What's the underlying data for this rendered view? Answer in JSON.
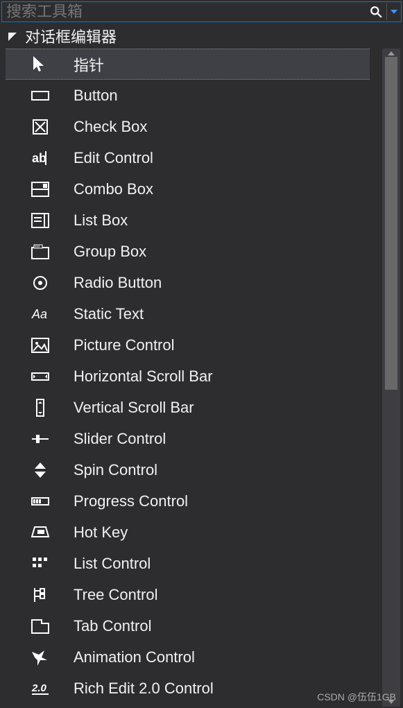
{
  "search": {
    "placeholder": "搜索工具箱"
  },
  "category": {
    "title": "对话框编辑器"
  },
  "items": [
    {
      "id": "pointer",
      "label": "指针",
      "icon": "pointer-icon",
      "selected": true
    },
    {
      "id": "button",
      "label": "Button",
      "icon": "button-icon",
      "selected": false
    },
    {
      "id": "check-box",
      "label": "Check Box",
      "icon": "checkbox-icon",
      "selected": false
    },
    {
      "id": "edit-control",
      "label": "Edit Control",
      "icon": "edit-icon",
      "selected": false
    },
    {
      "id": "combo-box",
      "label": "Combo Box",
      "icon": "combobox-icon",
      "selected": false
    },
    {
      "id": "list-box",
      "label": "List Box",
      "icon": "listbox-icon",
      "selected": false
    },
    {
      "id": "group-box",
      "label": "Group Box",
      "icon": "groupbox-icon",
      "selected": false
    },
    {
      "id": "radio-button",
      "label": "Radio Button",
      "icon": "radio-icon",
      "selected": false
    },
    {
      "id": "static-text",
      "label": "Static Text",
      "icon": "text-icon",
      "selected": false
    },
    {
      "id": "picture-control",
      "label": "Picture Control",
      "icon": "picture-icon",
      "selected": false
    },
    {
      "id": "hscroll",
      "label": "Horizontal Scroll Bar",
      "icon": "hscroll-icon",
      "selected": false
    },
    {
      "id": "vscroll",
      "label": "Vertical Scroll Bar",
      "icon": "vscroll-icon",
      "selected": false
    },
    {
      "id": "slider",
      "label": "Slider Control",
      "icon": "slider-icon",
      "selected": false
    },
    {
      "id": "spin",
      "label": "Spin Control",
      "icon": "spin-icon",
      "selected": false
    },
    {
      "id": "progress",
      "label": "Progress Control",
      "icon": "progress-icon",
      "selected": false
    },
    {
      "id": "hot-key",
      "label": "Hot Key",
      "icon": "hotkey-icon",
      "selected": false
    },
    {
      "id": "list-control",
      "label": "List Control",
      "icon": "listctrl-icon",
      "selected": false
    },
    {
      "id": "tree-control",
      "label": "Tree Control",
      "icon": "tree-icon",
      "selected": false
    },
    {
      "id": "tab-control",
      "label": "Tab Control",
      "icon": "tab-icon",
      "selected": false
    },
    {
      "id": "animation",
      "label": "Animation Control",
      "icon": "animation-icon",
      "selected": false
    },
    {
      "id": "rich-edit-2",
      "label": "Rich Edit 2.0 Control",
      "icon": "richedit-icon",
      "selected": false
    }
  ],
  "watermark": "CSDN @伍伍1GB"
}
